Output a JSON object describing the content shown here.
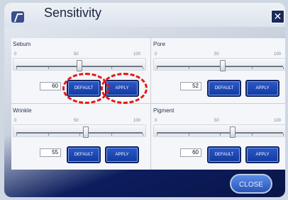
{
  "window": {
    "title": "Sensitivity"
  },
  "icons": {
    "app": "app-logo-icon",
    "close": "close-x-icon"
  },
  "scale": {
    "min": "0",
    "mid": "50",
    "max": "100"
  },
  "panels": [
    {
      "label": "Sebum",
      "value": "60",
      "default_label": "DEFAULT",
      "apply_label": "APPLY",
      "level": 0.5
    },
    {
      "label": "Pore",
      "value": "52",
      "default_label": "DEFAULT",
      "apply_label": "APPLY",
      "level": 0.52
    },
    {
      "label": "Wrinkle",
      "value": "55",
      "default_label": "DEFAULT",
      "apply_label": "APPLY",
      "level": 0.55
    },
    {
      "label": "Pigment",
      "value": "60",
      "default_label": "DEFAULT",
      "apply_label": "APPLY",
      "level": 0.6
    }
  ],
  "footer": {
    "close_label": "CLOSE"
  },
  "colors": {
    "accent": "#1a3fb0",
    "highlight": "#e81818",
    "dark_bg": "#0c1d5e"
  }
}
